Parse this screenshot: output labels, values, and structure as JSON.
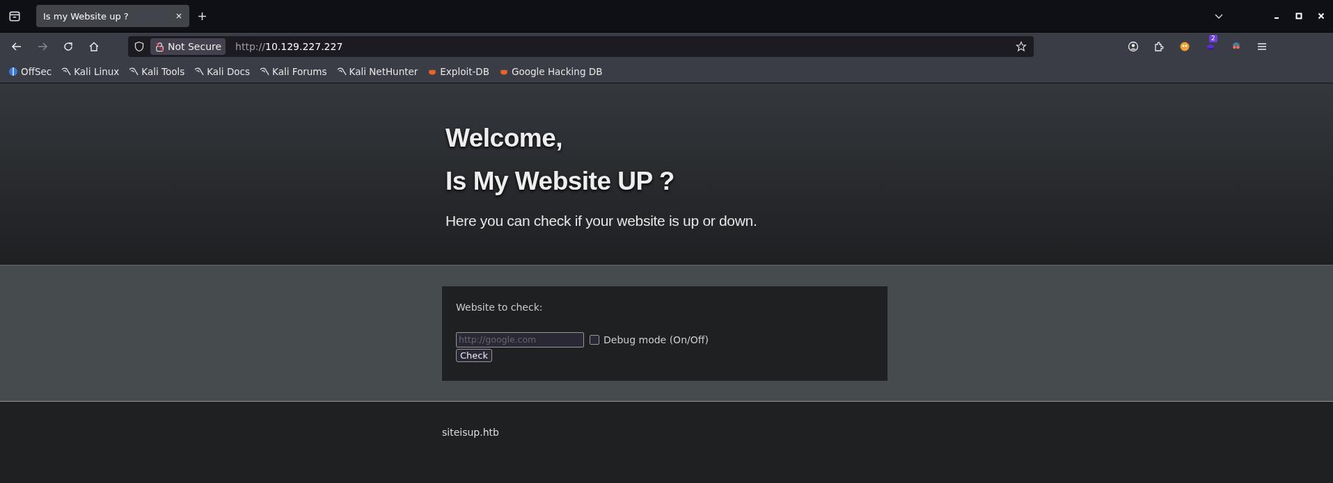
{
  "browser": {
    "tabs": [
      {
        "title": "Is my Website up ?",
        "selected": true
      }
    ],
    "address": {
      "security": "Not Secure",
      "prefix": "http://",
      "host": "10.129.227.227"
    },
    "extension_badge": "2",
    "bookmarks": [
      {
        "label": "OffSec",
        "kind": "offsec"
      },
      {
        "label": "Kali Linux",
        "kind": "kali"
      },
      {
        "label": "Kali Tools",
        "kind": "kali"
      },
      {
        "label": "Kali Docs",
        "kind": "kali"
      },
      {
        "label": "Kali Forums",
        "kind": "kali"
      },
      {
        "label": "Kali NetHunter",
        "kind": "kali"
      },
      {
        "label": "Exploit-DB",
        "kind": "bug"
      },
      {
        "label": "Google Hacking DB",
        "kind": "bug"
      }
    ]
  },
  "page": {
    "heading_1": "Welcome,",
    "heading_2": "Is My Website UP ?",
    "lead": "Here you can check if your website is up or down.",
    "form": {
      "label": "Website to check:",
      "placeholder": "http://google.com",
      "debug": {
        "label": "Debug mode (On/Off)",
        "checked": false
      },
      "button": "Check"
    },
    "footer": "siteisup.htb"
  }
}
